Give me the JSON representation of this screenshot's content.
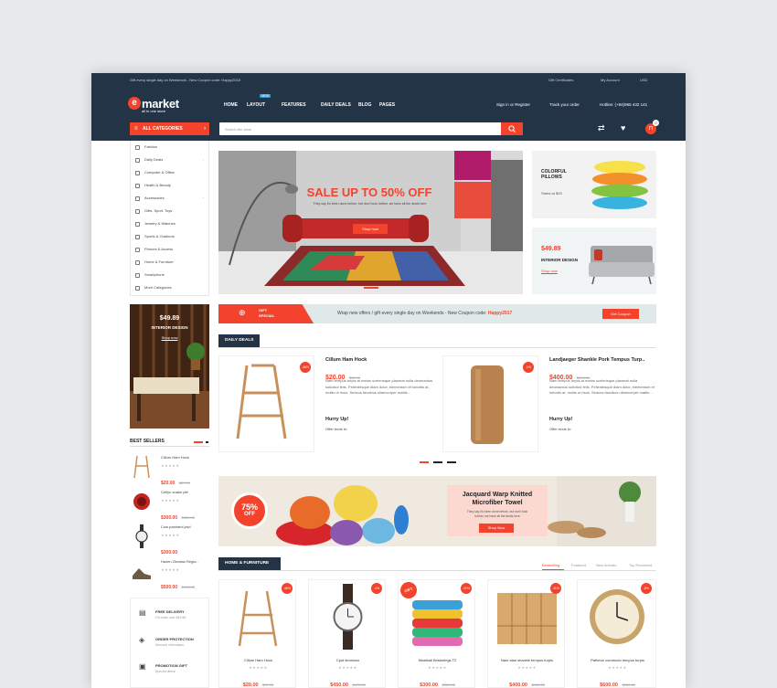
{
  "topbar": {
    "promo": "Gift every single day on Weekends - New Coupon code: Happy2018",
    "gift": "Gift Certificates",
    "account": "My Account",
    "currency": "USD"
  },
  "logo": {
    "letter": "e",
    "name": "market",
    "tagline": "all in one store"
  },
  "nav": {
    "items": [
      "HOME",
      "LAYOUT",
      "FEATURES",
      "DAILY DEALS",
      "BLOG",
      "PAGES"
    ],
    "new_badge": "NEW",
    "signin": "Sign in or Register",
    "track": "Track your order",
    "hotline": "Hotline: (+84)965 432 141"
  },
  "search": {
    "all_categories": "ALL CATEGORIES",
    "placeholder": "Search the store"
  },
  "cart": {
    "count": "0"
  },
  "categories": [
    "Fashion",
    "Daily Deals",
    "Computer & Office",
    "Health & Beauty",
    "Accessories",
    "Gifts, Sport, Toys",
    "Jewelry & Watches",
    "Sports & Outdoors",
    "Phones & Access",
    "Home & Furniture",
    "Smartphone",
    "More Categories"
  ],
  "hero": {
    "headline": "SALE UP TO 50% OFF",
    "sub": "They say it's been done before, but don't look further, we have all the deals here",
    "button": "Shop now"
  },
  "side_banners": {
    "pillows_title": "COLORFUL PILLOWS",
    "pillows_price": "Starts at $29",
    "interior_price": "$49.89",
    "interior_title": "INTERIOR DESIGN",
    "interior_link": "Shop now"
  },
  "left_banner": {
    "price": "$49.89",
    "title": "INTERIOR DESIGN",
    "link": "Shop now"
  },
  "gift_bar": {
    "label1": "GIFT",
    "label2": "SPECIAL",
    "text": "Wrap new offers / gift every single day on Weekends - New Coupon code:",
    "code": "Happy2017",
    "button": "Get Coupon"
  },
  "daily_deals": {
    "heading": "DAILY DEALS",
    "items": [
      {
        "title": "Cillum Ham Hock",
        "price": "$20.00",
        "old": "$37.99",
        "badge": "-46%",
        "desc": "Nam tempus turpis at metus scelerisque placerat nulla deumantos solicitud felis. Pellentesque diam dolor, elementum et lobortis at, mollis ut risus. Sedcus faucibus ullamcorper mattis...",
        "hurry": "Hurry Up!",
        "offer": "Offer ends in:"
      },
      {
        "title": "Landjaeger Shankle Pork Tempus Turp..",
        "price": "$400.00",
        "old": "$500.00",
        "badge": "-1%",
        "desc": "Nam tempus turpis at metus scelerisque placerat nulla deumantos solicitud felis. Pellentesque diam dolor, elementum et lobortis at, mollis ut risus. Sedcus faucibus ullamcorper mattis...",
        "hurry": "Hurry Up!",
        "offer": "Offer ends in:"
      }
    ]
  },
  "best_sellers": {
    "heading": "BEST SELLERS",
    "items": [
      {
        "name": "Cillum Ham Hock",
        "price": "$20.00",
        "old": "$37.99"
      },
      {
        "name": "Cetlyn snake pitt",
        "price": "$300.00",
        "old": "$380.00"
      },
      {
        "name": "Cow pastrami jowl",
        "price": "$300.00",
        "old": ""
      },
      {
        "name": "Hazen Zimalan Regla..",
        "price": "$500.00",
        "old": "$410.00"
      }
    ]
  },
  "towel_banner": {
    "discount": "75%",
    "off": "OFF",
    "title": "Jacquard Warp Knitted Microfiber Towel",
    "sub": "They say it's been done before, but don't look further, we have all the deals here",
    "button": "Shop Now"
  },
  "services": [
    {
      "title": "FREE DELIVERY",
      "sub": "On order over $49.86"
    },
    {
      "title": "ORDER PROTECTION",
      "sub": "Secured information"
    },
    {
      "title": "PROMOTION GIFT",
      "sub": "Special offers!"
    }
  ],
  "home_furniture": {
    "heading": "HOME & FURNITURE",
    "tabs": [
      "Bestselling",
      "Featured",
      "New Arrivals",
      "Top Reviewed"
    ],
    "products": [
      {
        "name": "Cillum Ham Hock",
        "price": "$20.00",
        "old": "$37.99",
        "badge": "-46%"
      },
      {
        "name": "Cpid densinso",
        "price": "$450.00",
        "old": "$470.00",
        "badge": "-4%"
      },
      {
        "name": "Meatball Brisketings T2",
        "price": "$300.00",
        "old": "$380.00",
        "badge": "-21%",
        "tag": "GIFT"
      },
      {
        "name": "Nam alan shankle tempus turpis",
        "price": "$400.00",
        "old": "$450.00",
        "badge": "-11%"
      },
      {
        "name": "Patheon commodo tempus turpis",
        "price": "$600.00",
        "old": "$650.00",
        "badge": "-8%"
      }
    ]
  },
  "colors": {
    "accent": "#f4432c",
    "navy": "#243447"
  }
}
